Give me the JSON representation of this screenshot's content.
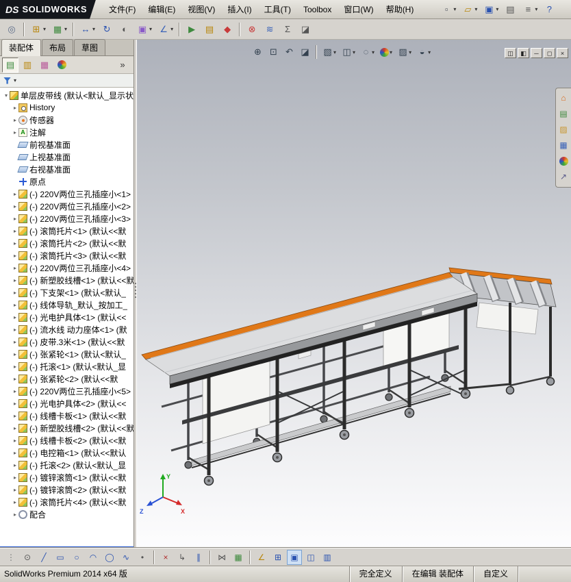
{
  "window": {
    "logo_prefix": "DS",
    "logo_text": "SOLIDWORKS",
    "menus": [
      "文件(F)",
      "编辑(E)",
      "视图(V)",
      "插入(I)",
      "工具(T)",
      "Toolbox",
      "窗口(W)",
      "帮助(H)"
    ],
    "quick_access": [
      {
        "name": "new-document",
        "glyph": "▫",
        "color": "#444a55",
        "dd": true
      },
      {
        "name": "open-document",
        "glyph": "▱",
        "color": "#b8860b",
        "dd": true
      },
      {
        "name": "save-document",
        "glyph": "▣",
        "color": "#2a52b0",
        "dd": true
      },
      {
        "name": "print-document",
        "glyph": "▤",
        "color": "#555555"
      },
      {
        "name": "options",
        "glyph": "≡",
        "color": "#555555",
        "dd": true
      },
      {
        "name": "help",
        "glyph": "?",
        "color": "#2a52b0"
      }
    ],
    "window_buttons": [
      {
        "name": "window-menu",
        "glyph": "◫"
      },
      {
        "name": "window-pane",
        "glyph": "◧"
      },
      {
        "name": "minimize-window",
        "glyph": "─"
      },
      {
        "name": "restore-window",
        "glyph": "◻"
      },
      {
        "name": "close-window",
        "glyph": "×"
      }
    ]
  },
  "toolbar": {
    "items": [
      {
        "name": "mate",
        "glyph": "◎",
        "color": "#5a6a88"
      },
      {
        "name": "insert-component",
        "glyph": "⊞",
        "color": "#b8860b",
        "dd": true,
        "sep": true
      },
      {
        "name": "linear-component-pattern",
        "glyph": "▦",
        "color": "#3e8a3e",
        "dd": true
      },
      {
        "name": "move-component",
        "glyph": "↔",
        "color": "#2a52b0",
        "dd": true,
        "sep": true
      },
      {
        "name": "rotate-component",
        "glyph": "↻",
        "color": "#2a52b0"
      },
      {
        "name": "show-hidden-components",
        "glyph": "◐",
        "color": "#555555"
      },
      {
        "name": "assembly-features",
        "glyph": "▣",
        "color": "#8a5ac8",
        "dd": true
      },
      {
        "name": "reference-geometry",
        "glyph": "∠",
        "color": "#3a62b8",
        "dd": true
      },
      {
        "name": "new-motion-study",
        "glyph": "▶",
        "color": "#3e8a3e",
        "sep": true
      },
      {
        "name": "bill-of-materials",
        "glyph": "▤",
        "color": "#b8860b"
      },
      {
        "name": "exploded-view",
        "glyph": "◆",
        "color": "#c83a3a"
      },
      {
        "name": "interference-detection",
        "glyph": "⊗",
        "color": "#c83a3a",
        "sep": true
      },
      {
        "name": "measure",
        "glyph": "≋",
        "color": "#3a62b8"
      },
      {
        "name": "mass-properties",
        "glyph": "Σ",
        "color": "#555555"
      },
      {
        "name": "section-properties",
        "glyph": "◪",
        "color": "#555555"
      }
    ]
  },
  "panel": {
    "tabs": [
      {
        "key": "assembly",
        "label": "装配体",
        "active": true
      },
      {
        "key": "layout",
        "label": "布局",
        "active": false
      },
      {
        "key": "sketch",
        "label": "草图",
        "active": false
      }
    ],
    "pane_icons": [
      {
        "name": "feature-manager-tab",
        "glyph": "▤",
        "color": "#3e8a3e",
        "active": true
      },
      {
        "name": "property-manager-tab",
        "glyph": "▥",
        "color": "#b8860b"
      },
      {
        "name": "configuration-manager-tab",
        "glyph": "▦",
        "color": "#b85a9a"
      },
      {
        "name": "display-manager-tab",
        "glyph": "BALL"
      },
      {
        "name": "collapse-pane",
        "glyph": "»",
        "color": "#333333"
      }
    ],
    "filter": {
      "arrow": "▾"
    },
    "tree": {
      "items": [
        {
          "level": 0,
          "icon": "asm",
          "exp": "open",
          "label": "单层皮带线 (默认<默认_显示状"
        },
        {
          "level": 1,
          "icon": "history",
          "exp": "closed",
          "label": "History"
        },
        {
          "level": 1,
          "icon": "sensor",
          "exp": "closed",
          "label": "传感器"
        },
        {
          "level": 1,
          "icon": "annotation",
          "exp": "closed",
          "label": "注解"
        },
        {
          "level": 1,
          "icon": "plane",
          "exp": "",
          "label": "前视基准面"
        },
        {
          "level": 1,
          "icon": "plane",
          "exp": "",
          "label": "上视基准面"
        },
        {
          "level": 1,
          "icon": "plane",
          "exp": "",
          "label": "右视基准面"
        },
        {
          "level": 1,
          "icon": "origin",
          "exp": "",
          "label": "原点"
        },
        {
          "level": 1,
          "icon": "part",
          "exp": "closed",
          "label": "(-) 220V两位三孔插座小<1>"
        },
        {
          "level": 1,
          "icon": "part",
          "exp": "closed",
          "label": "(-) 220V两位三孔插座小<2>"
        },
        {
          "level": 1,
          "icon": "part",
          "exp": "closed",
          "label": "(-) 220V两位三孔插座小<3>"
        },
        {
          "level": 1,
          "icon": "part",
          "exp": "closed",
          "label": "(-) 滚筒托片<1> (默认<<默"
        },
        {
          "level": 1,
          "icon": "part",
          "exp": "closed",
          "label": "(-) 滚筒托片<2> (默认<<默"
        },
        {
          "level": 1,
          "icon": "part",
          "exp": "closed",
          "label": "(-) 滚筒托片<3> (默认<<默"
        },
        {
          "level": 1,
          "icon": "part",
          "exp": "closed",
          "label": "(-) 220V两位三孔插座小<4>"
        },
        {
          "level": 1,
          "icon": "part",
          "exp": "closed",
          "label": "(-) 新塑胶线槽<1> (默认<<默"
        },
        {
          "level": 1,
          "icon": "part",
          "exp": "closed",
          "label": "(-) 下支架<1> (默认<默认_"
        },
        {
          "level": 1,
          "icon": "part",
          "exp": "closed",
          "label": "(-) 线体导轨_默认_按加工_"
        },
        {
          "level": 1,
          "icon": "part",
          "exp": "closed",
          "label": "(-) 光电护具体<1> (默认<<"
        },
        {
          "level": 1,
          "icon": "part",
          "exp": "closed",
          "label": "(-) 流水线 动力座体<1> (默"
        },
        {
          "level": 1,
          "icon": "part",
          "exp": "closed",
          "label": "(-) 皮带.3米<1> (默认<<默"
        },
        {
          "level": 1,
          "icon": "part",
          "exp": "closed",
          "label": "(-) 张紧轮<1> (默认<默认_"
        },
        {
          "level": 1,
          "icon": "part",
          "exp": "closed",
          "label": "(-) 托滚<1> (默认<默认_显"
        },
        {
          "level": 1,
          "icon": "part",
          "exp": "closed",
          "label": "(-) 张紧轮<2> (默认<<默"
        },
        {
          "level": 1,
          "icon": "part",
          "exp": "closed",
          "label": "(-) 220V两位三孔插座小<5>"
        },
        {
          "level": 1,
          "icon": "part",
          "exp": "closed",
          "label": "(-) 光电护具体<2> (默认<<"
        },
        {
          "level": 1,
          "icon": "part",
          "exp": "closed",
          "label": "(-) 线槽卡板<1> (默认<<默"
        },
        {
          "level": 1,
          "icon": "part",
          "exp": "closed",
          "label": "(-) 新塑胶线槽<2> (默认<<默"
        },
        {
          "level": 1,
          "icon": "part",
          "exp": "closed",
          "label": "(-) 线槽卡板<2> (默认<<默"
        },
        {
          "level": 1,
          "icon": "part",
          "exp": "closed",
          "label": "(-) 电控箱<1> (默认<<默认"
        },
        {
          "level": 1,
          "icon": "part",
          "exp": "closed",
          "label": "(-) 托滚<2> (默认<默认_显"
        },
        {
          "level": 1,
          "icon": "part",
          "exp": "closed",
          "label": "(-) 镀锌滚筒<1> (默认<<默"
        },
        {
          "level": 1,
          "icon": "part",
          "exp": "closed",
          "label": "(-) 镀锌滚筒<2> (默认<<默"
        },
        {
          "level": 1,
          "icon": "part",
          "exp": "closed",
          "label": "(-) 滚筒托片<4> (默认<<默"
        },
        {
          "level": 1,
          "icon": "mates",
          "exp": "closed",
          "label": "配合"
        }
      ]
    }
  },
  "viewport": {
    "heads_up": [
      {
        "name": "zoom-fit",
        "glyph": "⊕"
      },
      {
        "name": "zoom-area",
        "glyph": "⊡"
      },
      {
        "name": "previous-view",
        "glyph": "↶"
      },
      {
        "name": "section-view",
        "glyph": "◪"
      },
      {
        "name": "view-orientation",
        "glyph": "▧",
        "dd": true,
        "sep": true
      },
      {
        "name": "display-style",
        "glyph": "◫",
        "dd": true
      },
      {
        "name": "hide-show-items",
        "glyph": "◌",
        "dd": true
      },
      {
        "name": "edit-appearance",
        "glyph": "BALL",
        "dd": true
      },
      {
        "name": "apply-scene",
        "glyph": "▨",
        "dd": true
      },
      {
        "name": "view-settings",
        "glyph": "◒",
        "dd": true
      }
    ],
    "task_pane": [
      {
        "name": "solidworks-resources",
        "glyph": "⌂",
        "color": "#d86a1c"
      },
      {
        "name": "design-library",
        "glyph": "▤",
        "color": "#3e8a3e"
      },
      {
        "name": "file-explorer",
        "glyph": "▨",
        "color": "#c8962e"
      },
      {
        "name": "view-palette",
        "glyph": "▦",
        "color": "#3a62b8"
      },
      {
        "name": "appearances-scenes",
        "glyph": "BALL"
      },
      {
        "name": "custom-properties",
        "glyph": "↗",
        "color": "#5a5a8a"
      }
    ],
    "triad": {
      "x": "X",
      "y": "Y",
      "z": "Z"
    }
  },
  "bottom_toolbar": {
    "items": [
      {
        "name": "toolbar-handle",
        "glyph": "⋮",
        "color": "#777777"
      },
      {
        "name": "select-sketch",
        "glyph": "⊙",
        "color": "#555555"
      },
      {
        "name": "line",
        "glyph": "╱",
        "color": "#2a52b0"
      },
      {
        "name": "corner-rectangle",
        "glyph": "▭",
        "color": "#2a52b0"
      },
      {
        "name": "circle",
        "glyph": "○",
        "color": "#2a52b0"
      },
      {
        "name": "centerpoint-arc",
        "glyph": "◠",
        "color": "#2a52b0"
      },
      {
        "name": "ellipse",
        "glyph": "◯",
        "color": "#2a52b0"
      },
      {
        "name": "spline",
        "glyph": "∿",
        "color": "#2a52b0"
      },
      {
        "name": "point",
        "glyph": "•",
        "color": "#555555"
      },
      {
        "name": "trim-entities",
        "glyph": "×",
        "color": "#b03030",
        "sep": true
      },
      {
        "name": "convert-entities",
        "glyph": "↳",
        "color": "#555555"
      },
      {
        "name": "offset-entities",
        "glyph": "∥",
        "color": "#2a52b0"
      },
      {
        "name": "mirror-entities",
        "glyph": "⋈",
        "color": "#555555",
        "sep": true
      },
      {
        "name": "linear-sketch-pattern",
        "glyph": "▦",
        "color": "#3e8a3e"
      },
      {
        "name": "angle-snap",
        "glyph": "∠",
        "color": "#b8860b",
        "sep": true
      },
      {
        "name": "display-grid",
        "glyph": "⊞",
        "color": "#2a52b0"
      },
      {
        "name": "shaded-sketch-contours",
        "glyph": "▣",
        "color": "#2a52b0",
        "active": true
      },
      {
        "name": "section-display",
        "glyph": "◫",
        "color": "#2a52b0"
      },
      {
        "name": "sketch-table",
        "glyph": "▥",
        "color": "#2a52b0"
      }
    ]
  },
  "status_bar": {
    "left": "SolidWorks Premium 2014 x64 版",
    "fully_defined": "完全定义",
    "editing": "在编辑 装配体",
    "custom": "自定义"
  }
}
